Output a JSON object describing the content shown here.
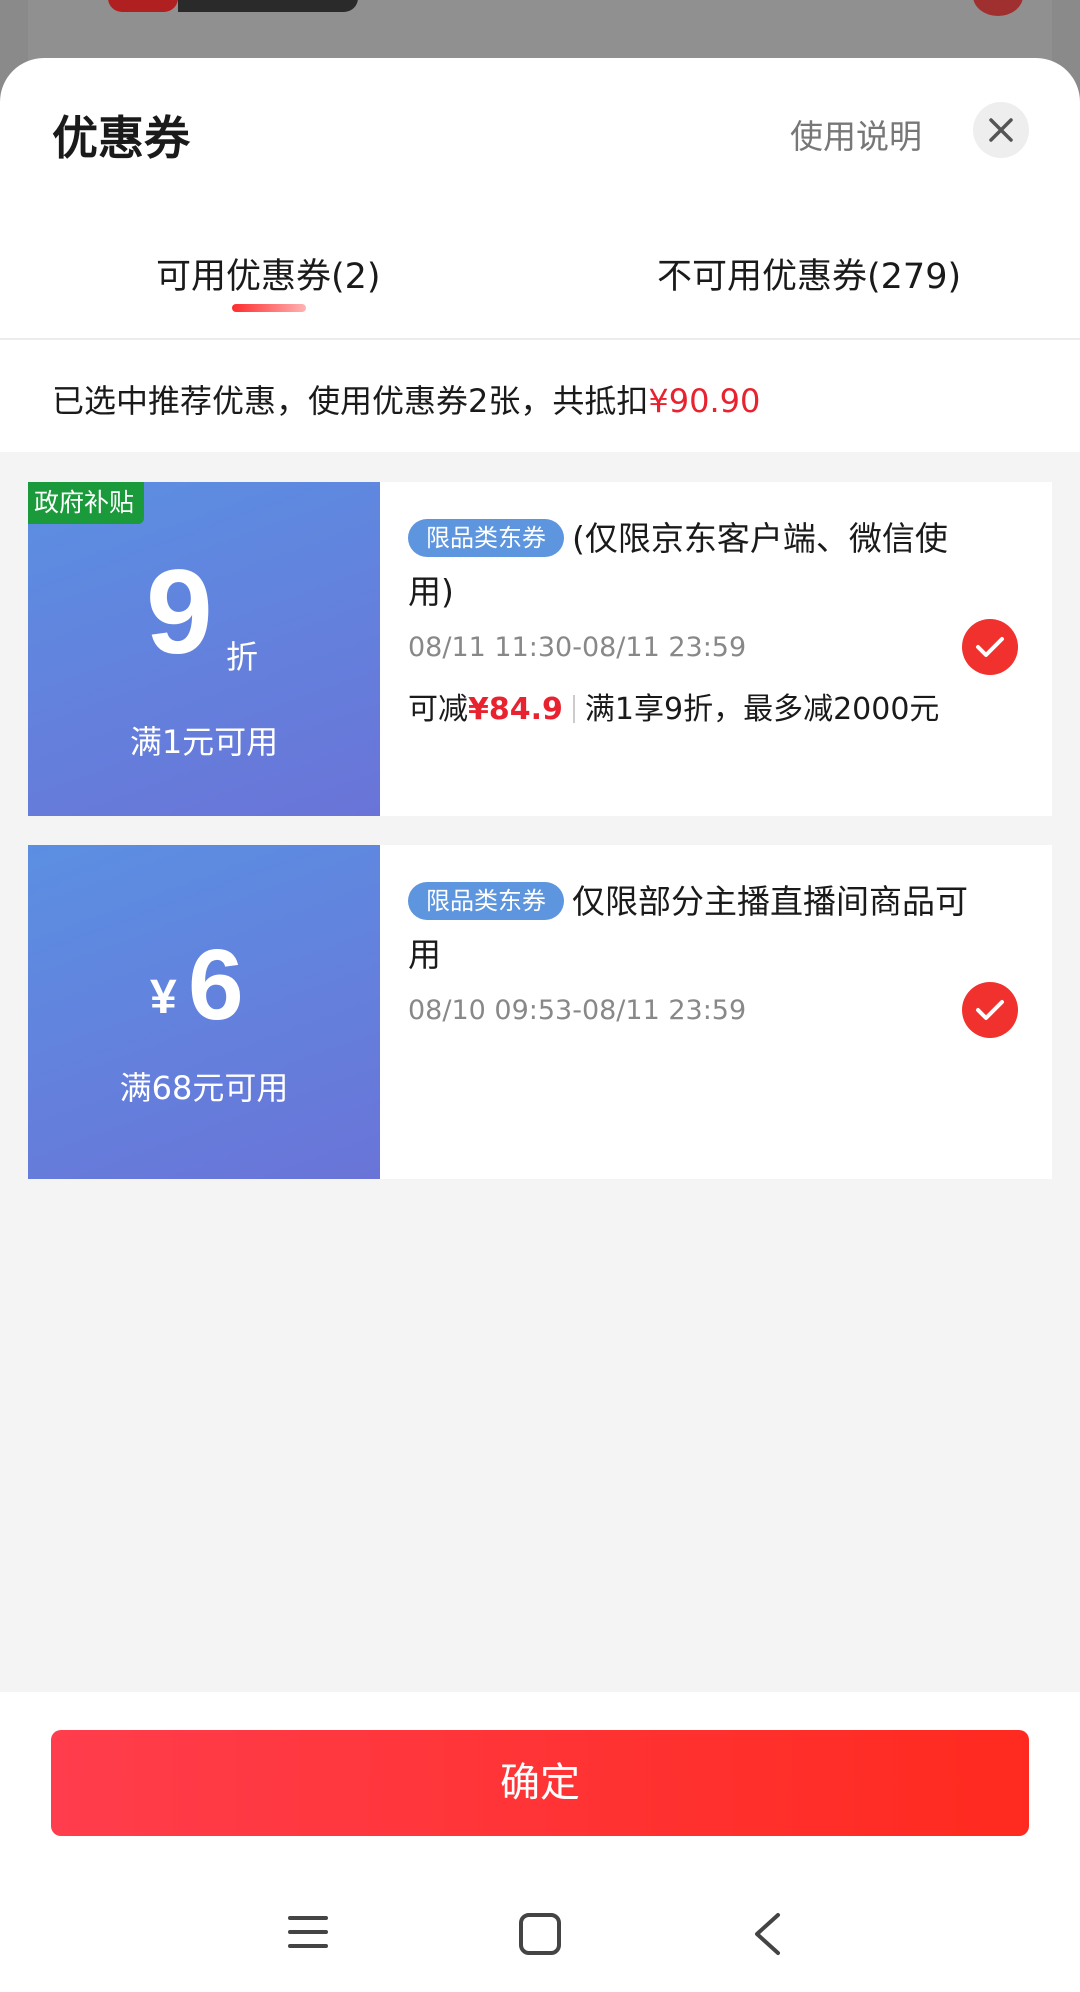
{
  "sheet": {
    "title": "优惠券",
    "help_link": "使用说明",
    "close_icon": "close-icon"
  },
  "tabs": [
    {
      "label": "可用优惠券(2)",
      "active": true
    },
    {
      "label": "不可用优惠券(279)",
      "active": false
    }
  ],
  "summary": {
    "text": "已选中推荐优惠，使用优惠券2张，共抵扣",
    "amount": "¥90.90"
  },
  "coupons": [
    {
      "corner_tag": "政府补贴",
      "value": "9",
      "unit": "折",
      "threshold": "满1元可用",
      "badge": "限品类东券",
      "title": "(仅限京东客户端、微信使用)",
      "validity": "08/11 11:30-08/11 23:59",
      "benefit_prefix": "可减",
      "benefit_amount": "¥84.9",
      "benefit_desc": "满1享9折，最多减2000元",
      "selected": true
    },
    {
      "currency": "¥",
      "value": "6",
      "threshold": "满68元可用",
      "badge": "限品类东券",
      "title": "仅限部分主播直播间商品可用",
      "validity": "08/10 09:53-08/11 23:59",
      "selected": true
    }
  ],
  "footer": {
    "confirm_label": "确定"
  },
  "colors": {
    "accent": "#e8232f",
    "badge_blue": "#5d95de",
    "coupon_gradient_start": "#5b8fe2",
    "coupon_gradient_end": "#6a74d8",
    "gov_tag": "#1a9a3a"
  }
}
